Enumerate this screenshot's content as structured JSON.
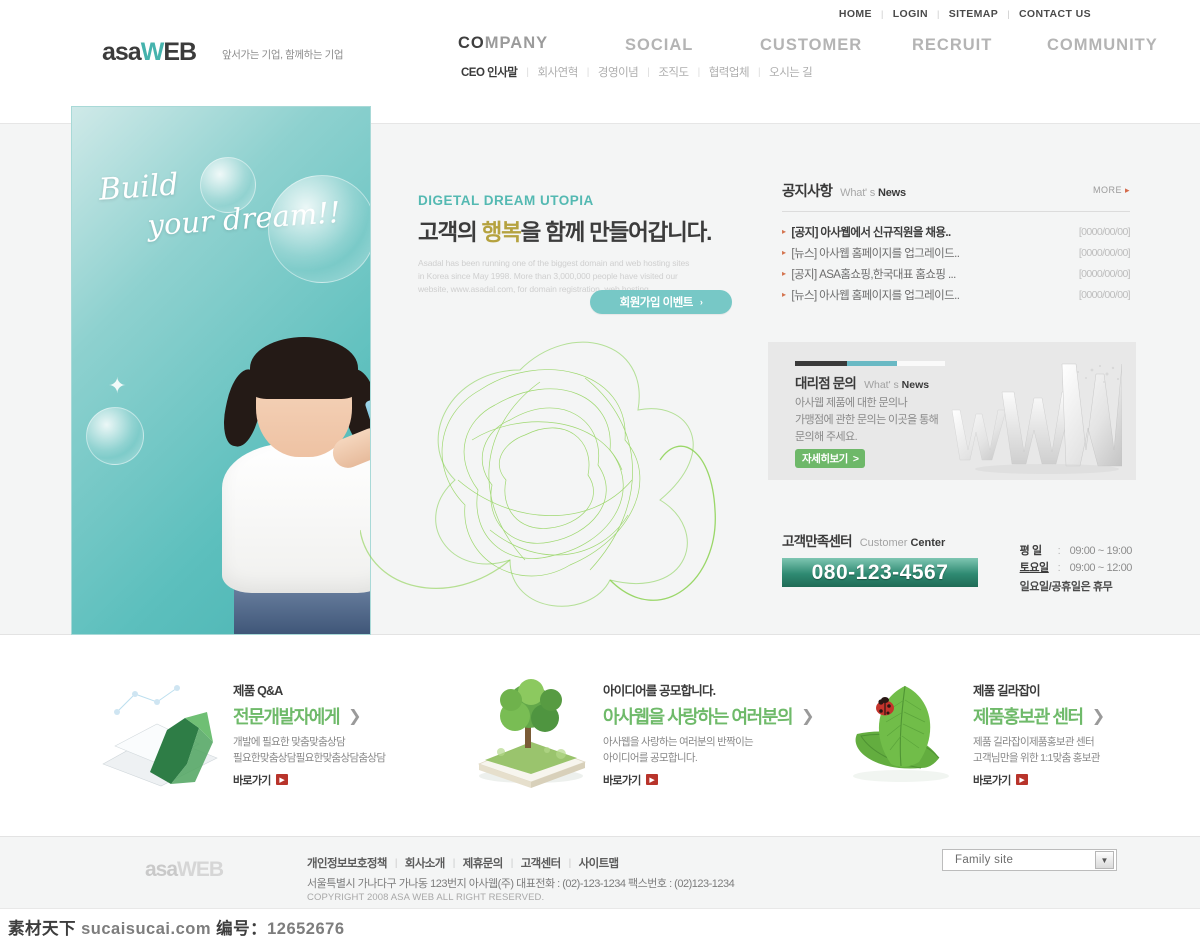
{
  "utility": {
    "links": [
      "HOME",
      "LOGIN",
      "SITEMAP",
      "CONTACT US"
    ],
    "separator": "|"
  },
  "header": {
    "logo": {
      "part1": "asa",
      "part2": "W",
      "part3": "EB"
    },
    "slogan": "앞서가는 기업, 함께하는 기업",
    "gnb": [
      {
        "label": "COMPANY",
        "active_prefix": "CO",
        "rest": "MPANY",
        "active": true
      },
      {
        "label": "SOCIAL",
        "active": false
      },
      {
        "label": "CUSTOMER",
        "active": false
      },
      {
        "label": "RECRUIT",
        "active": false
      },
      {
        "label": "COMMUNITY",
        "active": false
      }
    ],
    "snb": [
      {
        "label": "CEO 인사말",
        "active": true
      },
      {
        "label": "회사연혁",
        "active": false
      },
      {
        "label": "경영이념",
        "active": false
      },
      {
        "label": "조직도",
        "active": false
      },
      {
        "label": "협력업체",
        "active": false
      },
      {
        "label": "오시는 길",
        "active": false
      }
    ],
    "snb_separator": "|"
  },
  "hero": {
    "script_line1": "Build",
    "script_line2": "your dream!!",
    "eyebrow": "DIGETAL DREAM UTOPIA",
    "head_pre": "고객의 ",
    "head_hl": "행복",
    "head_post": "을 함께 만들어갑니다.",
    "body": "Asadal has been running one of the biggest domain and web hosting sites in Korea since May 1998. More than 3,000,000 people have visited our website, www.asadal.com, for domain registration, web hosting.",
    "event_button": "회원가입 이벤트",
    "event_button_arrow": "›"
  },
  "notice": {
    "title_ko": "공지사항",
    "title_en_light": "What' s ",
    "title_en_bold": "News",
    "more": "MORE",
    "more_arrow": "▸",
    "bullet": "▸",
    "items": [
      {
        "title": "[공지] 아사웹에서 신규직원을 채용..",
        "date": "[0000/00/00]"
      },
      {
        "title": "[뉴스] 아사웹 홈페이지를 업그레이드..",
        "date": "[0000/00/00]"
      },
      {
        "title": "[공지] ASA홈쇼핑,한국대표 홈쇼핑 ...",
        "date": "[0000/00/00]"
      },
      {
        "title": "[뉴스] 아사웹 홈페이지를 업그레이드..",
        "date": "[0000/00/00]"
      }
    ]
  },
  "dealer": {
    "title_ko": "대리점 문의",
    "title_en_light": "What' s ",
    "title_en_bold": "News",
    "body_line1": "아사웹 제품에 대한 문의나",
    "body_line2": "가맹점에 관한 문의는 이곳을 통해",
    "body_line3": "문의해 주세요.",
    "button": "자세히보기",
    "button_arrow": ">",
    "art_text": "WWW",
    "bar_colors": [
      "#3a3a3a",
      "#69b9c4",
      "#fafafa"
    ]
  },
  "customer_center": {
    "title_ko": "고객만족센터",
    "title_en_light": "Customer ",
    "title_en_bold": "Center",
    "phone": "080-123-4567",
    "hours": [
      {
        "label": "평 일",
        "colon": ":",
        "value": "09:00 ~ 19:00"
      },
      {
        "label": "토요일",
        "colon": ":",
        "value": "09:00 ~ 12:00"
      }
    ],
    "note": "일요일/공휴일은 휴무"
  },
  "panels": [
    {
      "art": "laptop-chart",
      "kicker": "제품 Q&A",
      "title": "전문개발자에게",
      "chevron": "❯",
      "desc_line1": "개발에 필요한 맞춤맞춤상담",
      "desc_line2": "필요한맞춤상담필요한맞춤상담춤상담",
      "go": "바로가기",
      "go_icon": "▶"
    },
    {
      "art": "book-tree",
      "kicker": "아이디어를 공모합니다.",
      "title": "아사웹을 사랑하는 여러분의",
      "chevron": "❯",
      "desc_line1": "아사웹을 사랑하는 여러분의 반짝이는",
      "desc_line2": "아이디어를 공모합니다.",
      "go": "바로가기",
      "go_icon": "▶"
    },
    {
      "art": "leaf-ladybug",
      "kicker": "제품 길라잡이",
      "title": "제품홍보관 센터",
      "chevron": "❯",
      "desc_line1": "제품 길라잡이제품홍보관 센터",
      "desc_line2": "고객님만을 위한 1:1맞춤 홍보관",
      "go": "바로가기",
      "go_icon": "▶"
    }
  ],
  "footer": {
    "logo_part1": "asa",
    "logo_part2": "WEB",
    "links": [
      "개인정보보호정책",
      "회사소개",
      "제휴문의",
      "고객센터",
      "사이트맵"
    ],
    "separator": "|",
    "address": "서울특별시 가나다구 가나동 123번지  아사웹(주) 대표전화 : (02)-123-1234 팩스번호 : (02)123-1234",
    "copyright": "COPYRIGHT 2008 ASA WEB  ALL RIGHT RESERVED.",
    "family_site": {
      "value": "Family site",
      "arrow": "▼"
    }
  },
  "watermark": {
    "cn": "素材天下",
    "site": "sucaisucai.com",
    "label": "编号：",
    "id": "12652676"
  },
  "colors": {
    "teal": "#49b3b2",
    "green": "#6fba6a",
    "accent_gold": "#b5a23f",
    "band_bg": "#f4f5f5"
  }
}
